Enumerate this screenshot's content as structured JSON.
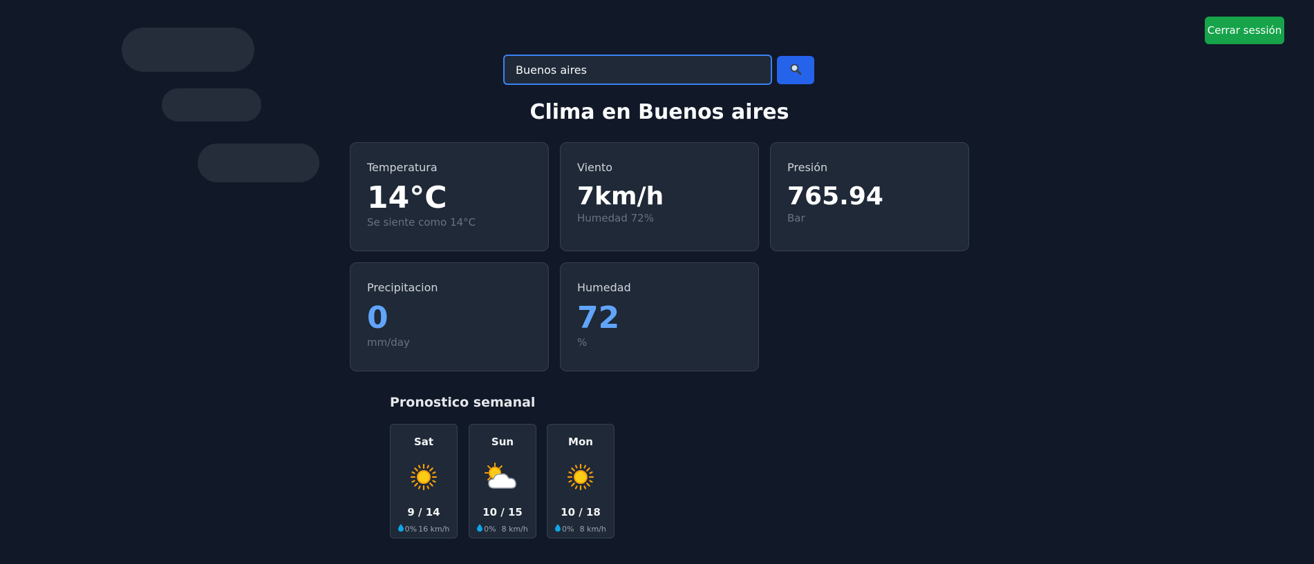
{
  "header": {
    "logout_label": "Cerrar sessión"
  },
  "search": {
    "value": "Buenos aires",
    "placeholder": "",
    "button_icon": "search-icon"
  },
  "title": "Clima en Buenos aires",
  "cards": {
    "temperature": {
      "label": "Temperatura",
      "value": "14°C",
      "sub": "Se siente como 14°C"
    },
    "wind": {
      "label": "Viento",
      "value": "7km/h",
      "sub": "Humedad 72%"
    },
    "pressure": {
      "label": "Presión",
      "value": "765.94",
      "sub": "Bar"
    },
    "precipitation": {
      "label": "Precipitacion",
      "value": "0",
      "sub": "mm/day"
    },
    "humidity": {
      "label": "Humedad",
      "value": "72",
      "sub": "%"
    }
  },
  "forecast": {
    "title": "Pronostico semanal",
    "days": [
      {
        "day": "Sat",
        "icon": "sun-icon",
        "temps": "9 / 14",
        "rain": "0%",
        "wind": "16 km/h"
      },
      {
        "day": "Sun",
        "icon": "sun-behind-cloud-icon",
        "temps": "10 / 15",
        "rain": "0%",
        "wind": "8 km/h"
      },
      {
        "day": "Mon",
        "icon": "sun-icon",
        "temps": "10 / 18",
        "rain": "0%",
        "wind": "8 km/h"
      }
    ]
  },
  "colors": {
    "background": "#111827",
    "card": "#1f2937",
    "accent_blue": "#2563eb",
    "value_blue": "#60a5fa",
    "logout_green": "#16a34a"
  }
}
